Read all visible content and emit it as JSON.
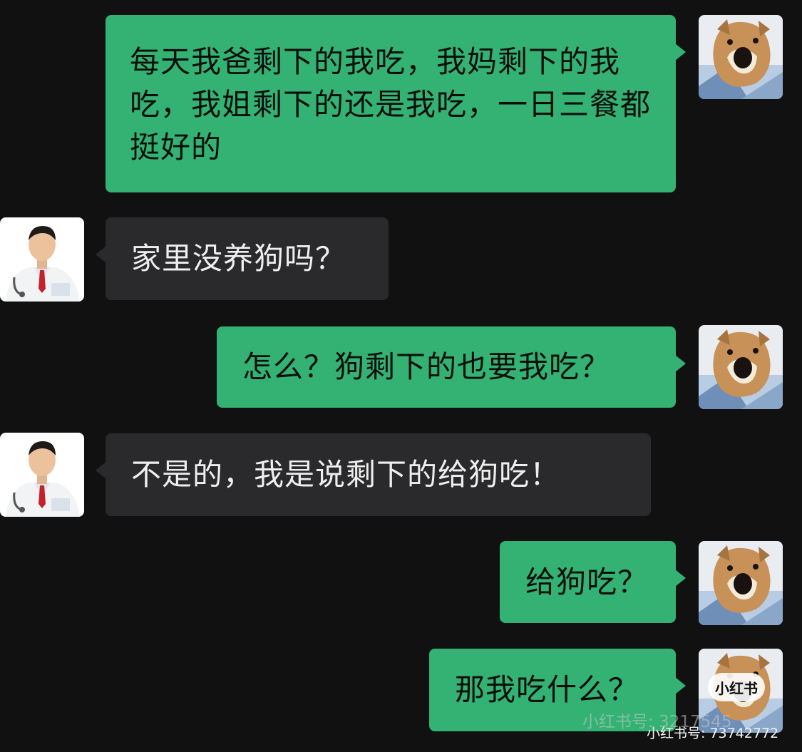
{
  "messages": [
    {
      "from": "me",
      "text": "每天我爸剩下的我吃，我妈剩下的我吃，我姐剩下的还是我吃，一日三餐都挺好的"
    },
    {
      "from": "doctor",
      "text": "家里没养狗吗？"
    },
    {
      "from": "me",
      "text": "怎么？狗剩下的也要我吃？"
    },
    {
      "from": "doctor",
      "text": "不是的，我是说剩下的给狗吃！"
    },
    {
      "from": "me",
      "text": "给狗吃？"
    },
    {
      "from": "me",
      "text": "那我吃什么？"
    }
  ],
  "watermark": {
    "badge": "小红书",
    "id_line_1": "小红书号: 3217545",
    "id_line_2": "小红书号: 73742772"
  },
  "colors": {
    "background": "#111111",
    "sent_bubble": "#33b274",
    "received_bubble": "#2a2a2c"
  },
  "icons": {
    "me_avatar": "shiba-dog-avatar",
    "doctor_avatar": "doctor-avatar"
  }
}
